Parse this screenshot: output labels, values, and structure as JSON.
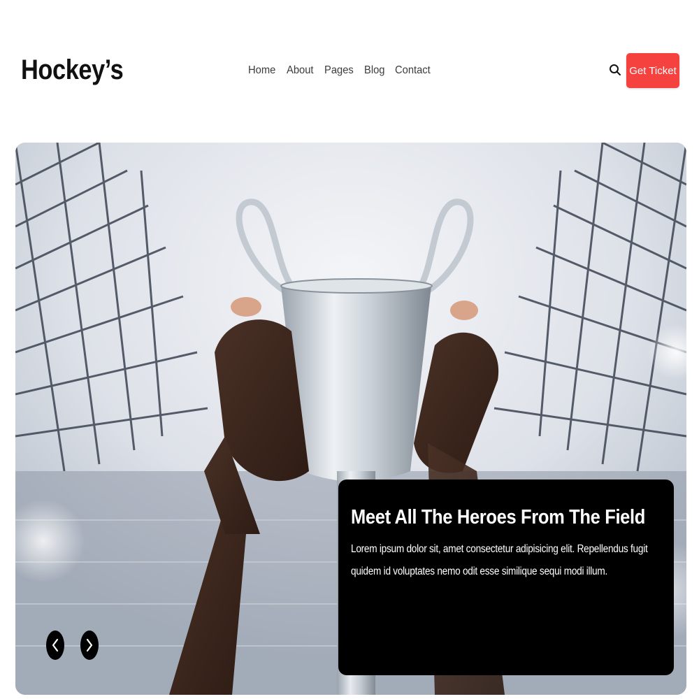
{
  "brand": {
    "logo_text": "Hockey’s"
  },
  "nav": {
    "items": [
      {
        "label": "Home"
      },
      {
        "label": "About"
      },
      {
        "label": "Pages"
      },
      {
        "label": "Blog"
      },
      {
        "label": "Contact"
      }
    ]
  },
  "header": {
    "search_icon": "search-icon",
    "cta_label": "Get Ticket",
    "cta_color": "#f5423f"
  },
  "hero": {
    "image_alt": "hands-raising-silver-trophy-in-stadium",
    "title": "Meet All The Heroes From The Field",
    "text": "Lorem ipsum dolor sit, amet consectetur adipisicing elit. Repellendus fugit quidem id voluptates nemo odit esse similique sequi modi illum.",
    "prev_icon": "chevron-left-icon",
    "next_icon": "chevron-right-icon"
  }
}
